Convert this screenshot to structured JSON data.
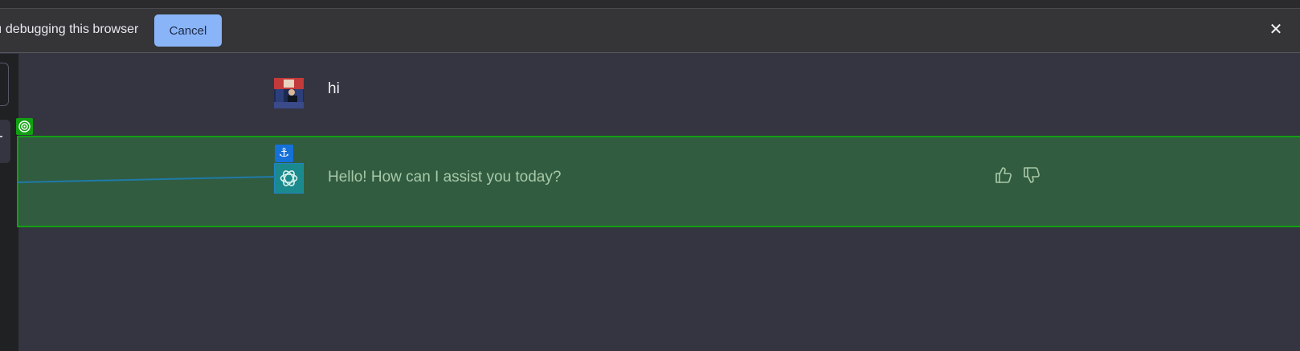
{
  "debug_bar": {
    "message": "ı debugging this browser",
    "cancel_label": "Cancel",
    "close_label": "✕"
  },
  "chat": {
    "user_message": "hi",
    "assistant_message": "Hello! How can I assist you today?"
  },
  "overlay": {
    "anchor_glyph": "⚓"
  },
  "icons": {
    "close": "close-icon",
    "target": "target-icon",
    "anchor": "anchor-icon",
    "thumbs_up": "thumbs-up-icon",
    "thumbs_down": "thumbs-down-icon",
    "openai_logo": "openai-logo-icon"
  },
  "colors": {
    "debug_bar_bg": "#353538",
    "cancel_button": "#8ab4f8",
    "chat_bg": "#343541",
    "sidebar_bg": "#202123",
    "highlight_fill": "#315c40",
    "highlight_border": "#12a012",
    "anchor_badge": "#1570d8",
    "connector_line": "#1f7aa8"
  }
}
